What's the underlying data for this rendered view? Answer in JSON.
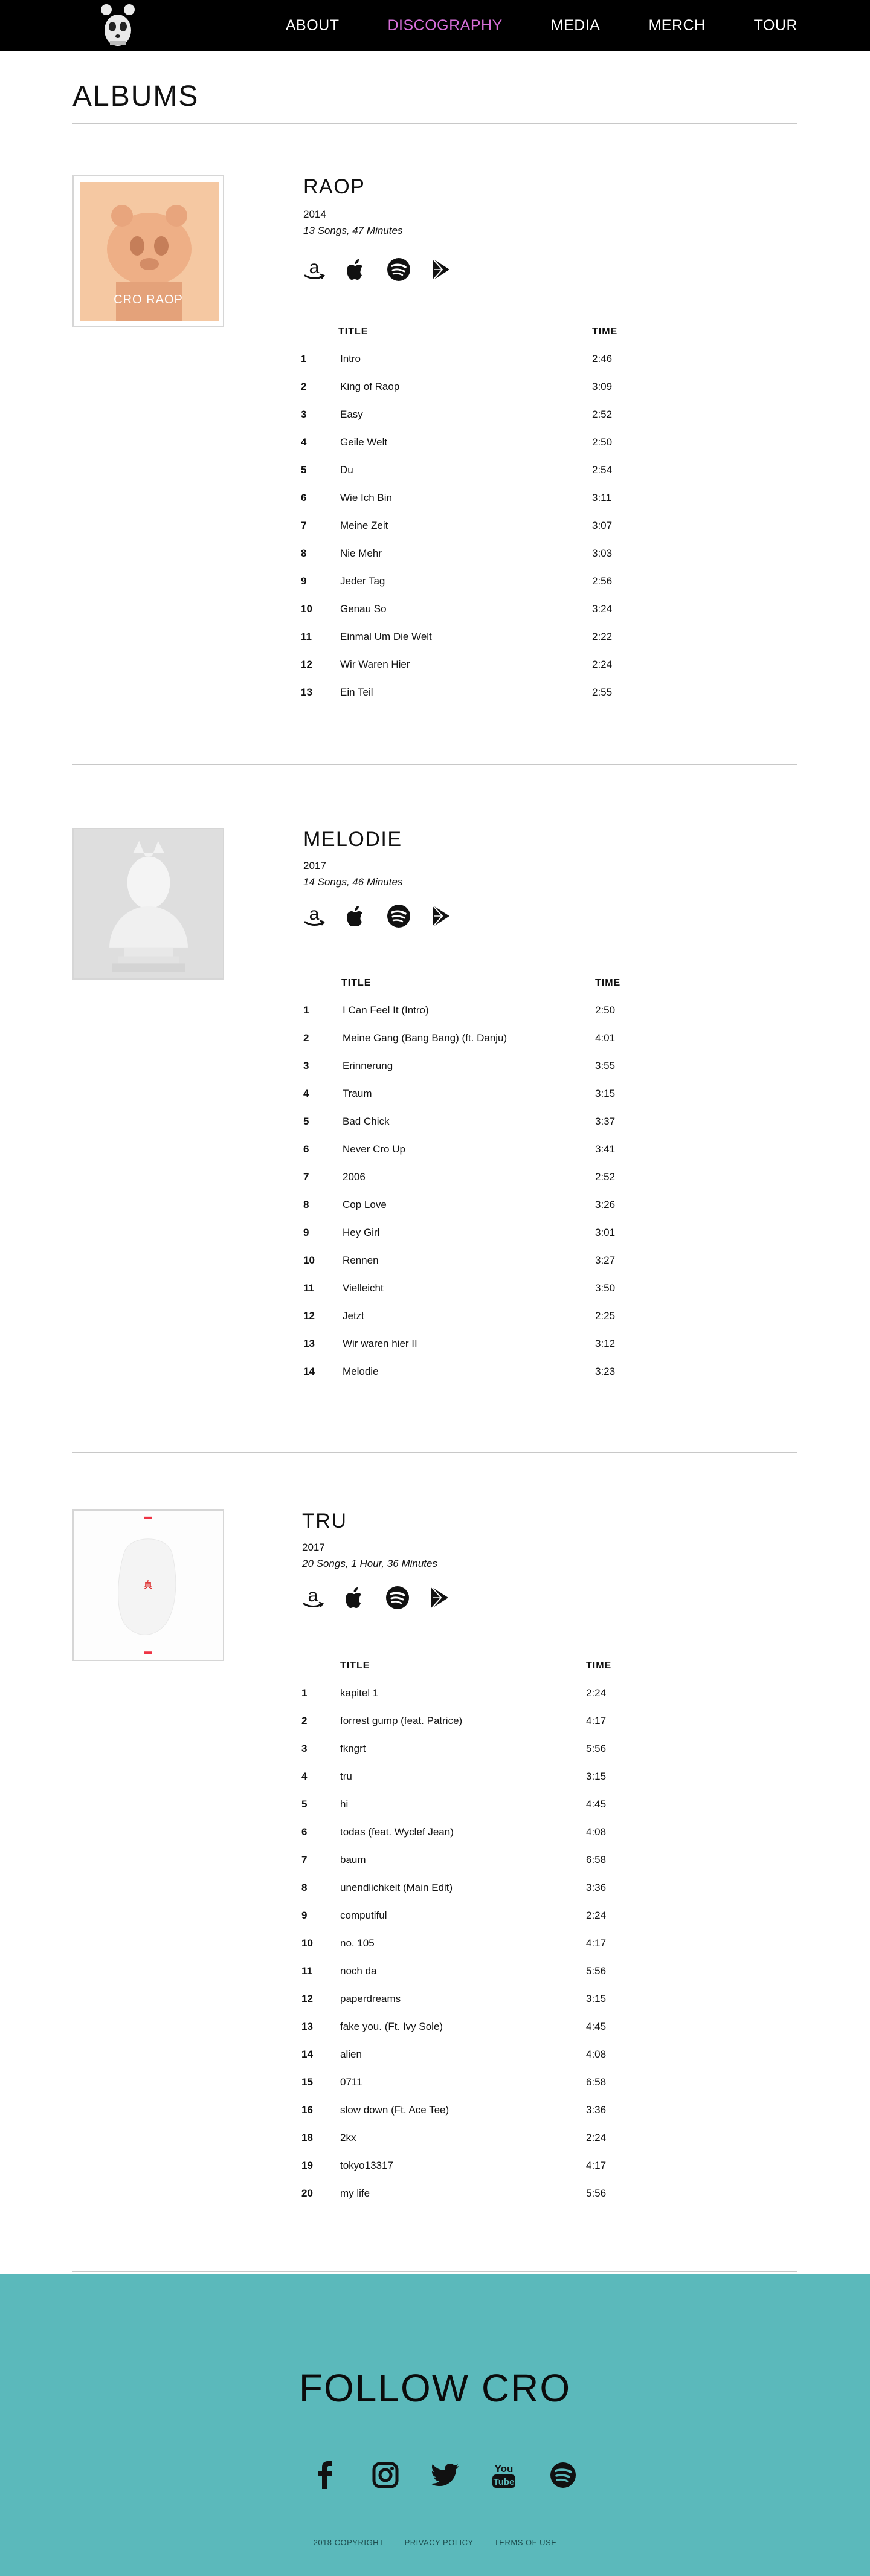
{
  "nav": {
    "logo_alt": "Cro panda logo",
    "links": [
      {
        "label": "ABOUT",
        "active": false
      },
      {
        "label": "DISCOGRAPHY",
        "active": true
      },
      {
        "label": "MEDIA",
        "active": false
      },
      {
        "label": "MERCH",
        "active": false
      },
      {
        "label": "TOUR",
        "active": false
      }
    ]
  },
  "page": {
    "title": "ALBUMS"
  },
  "table_headers": {
    "title": "TITLE",
    "time": "TIME"
  },
  "store_icons": [
    "amazon-icon",
    "apple-icon",
    "spotify-icon",
    "google-play-icon"
  ],
  "albums": [
    {
      "name": "RAOP",
      "year": "2014",
      "meta": "13 Songs, 47 Minutes",
      "cover_text": "CRO RAOP",
      "tracks": [
        {
          "num": "1",
          "title": "Intro",
          "time": "2:46"
        },
        {
          "num": "2",
          "title": "King of Raop",
          "time": "3:09"
        },
        {
          "num": "3",
          "title": "Easy",
          "time": "2:52"
        },
        {
          "num": "4",
          "title": "Geile Welt",
          "time": "2:50"
        },
        {
          "num": "5",
          "title": "Du",
          "time": "2:54"
        },
        {
          "num": "6",
          "title": "Wie Ich Bin",
          "time": "3:11"
        },
        {
          "num": "7",
          "title": "Meine Zeit",
          "time": "3:07"
        },
        {
          "num": "8",
          "title": "Nie Mehr",
          "time": "3:03"
        },
        {
          "num": "9",
          "title": "Jeder Tag",
          "time": "2:56"
        },
        {
          "num": "10",
          "title": "Genau So",
          "time": "3:24"
        },
        {
          "num": "11",
          "title": "Einmal Um Die Welt",
          "time": "2:22"
        },
        {
          "num": "12",
          "title": "Wir Waren Hier",
          "time": "2:24"
        },
        {
          "num": "13",
          "title": "Ein Teil",
          "time": "2:55"
        }
      ]
    },
    {
      "name": "MELODIE",
      "year": "2017",
      "meta": "14 Songs, 46 Minutes",
      "cover_text": "",
      "tracks": [
        {
          "num": "1",
          "title": "I Can Feel It (Intro)",
          "time": "2:50"
        },
        {
          "num": "2",
          "title": "Meine Gang (Bang Bang) (ft. Danju)",
          "time": "4:01"
        },
        {
          "num": "3",
          "title": "Erinnerung",
          "time": "3:55"
        },
        {
          "num": "4",
          "title": "Traum",
          "time": "3:15"
        },
        {
          "num": "5",
          "title": "Bad Chick",
          "time": "3:37"
        },
        {
          "num": "6",
          "title": "Never Cro Up",
          "time": "3:41"
        },
        {
          "num": "7",
          "title": "2006",
          "time": "2:52"
        },
        {
          "num": "8",
          "title": "Cop Love",
          "time": "3:26"
        },
        {
          "num": "9",
          "title": "Hey Girl",
          "time": "3:01"
        },
        {
          "num": "10",
          "title": "Rennen",
          "time": "3:27"
        },
        {
          "num": "11",
          "title": "Vielleicht",
          "time": "3:50"
        },
        {
          "num": "12",
          "title": "Jetzt",
          "time": "2:25"
        },
        {
          "num": "13",
          "title": "Wir waren hier II",
          "time": "3:12"
        },
        {
          "num": "14",
          "title": "Melodie",
          "time": "3:23"
        }
      ]
    },
    {
      "name": "TRU",
      "year": "2017",
      "meta": "20 Songs, 1 Hour, 36 Minutes",
      "cover_text": "",
      "tracks": [
        {
          "num": "1",
          "title": "kapitel 1",
          "time": "2:24"
        },
        {
          "num": "2",
          "title": "forrest gump (feat. Patrice)",
          "time": "4:17"
        },
        {
          "num": "3",
          "title": "fkngrt",
          "time": "5:56"
        },
        {
          "num": "4",
          "title": "tru",
          "time": "3:15"
        },
        {
          "num": "5",
          "title": "hi",
          "time": "4:45"
        },
        {
          "num": "6",
          "title": "todas (feat. Wyclef Jean)",
          "time": "4:08"
        },
        {
          "num": "7",
          "title": "baum",
          "time": "6:58"
        },
        {
          "num": "8",
          "title": "unendlichkeit (Main Edit)",
          "time": "3:36"
        },
        {
          "num": "9",
          "title": "computiful",
          "time": "2:24"
        },
        {
          "num": "10",
          "title": "no. 105",
          "time": "4:17"
        },
        {
          "num": "11",
          "title": "noch da",
          "time": "5:56"
        },
        {
          "num": "12",
          "title": "paperdreams",
          "time": "3:15"
        },
        {
          "num": "13",
          "title": "fake you. (Ft. Ivy Sole)",
          "time": "4:45"
        },
        {
          "num": "14",
          "title": "alien",
          "time": "4:08"
        },
        {
          "num": "15",
          "title": "0711",
          "time": "6:58"
        },
        {
          "num": "16",
          "title": "slow down (Ft. Ace Tee)",
          "time": "3:36"
        },
        {
          "num": "18",
          "title": "2kx",
          "time": "2:24"
        },
        {
          "num": "19",
          "title": "tokyo13317",
          "time": "4:17"
        },
        {
          "num": "20",
          "title": "my life",
          "time": "5:56"
        }
      ]
    }
  ],
  "footer": {
    "title": "FOLLOW CRO",
    "social_icons": [
      "facebook-icon",
      "instagram-icon",
      "twitter-icon",
      "youtube-icon",
      "spotify-icon"
    ],
    "youtube_text": [
      "You",
      "Tube"
    ],
    "links": [
      "2018 COPYRIGHT",
      "PRIVACY POLICY",
      "TERMS OF USE"
    ],
    "background_color": "#5bb9bb"
  },
  "colors": {
    "nav_bg": "#000000",
    "nav_active": "#d76fd9",
    "divider": "#c8c8c8"
  }
}
